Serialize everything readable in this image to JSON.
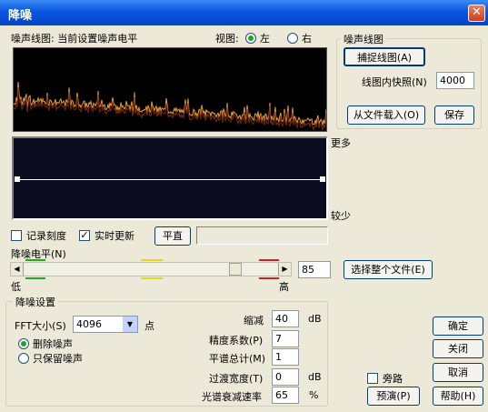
{
  "window": {
    "title": "降噪",
    "close_glyph": "✕"
  },
  "graph": {
    "label": "噪声线图: 当前设置噪声电平",
    "view_label": "视图:",
    "view_left": "左",
    "view_right": "右",
    "view_selected": "左"
  },
  "noise_profile": {
    "group_label": "噪声线图",
    "capture_button": "捕捉线图(A)",
    "snapshots_label": "线图内快照(N)",
    "snapshots_value": "4000",
    "load_button": "从文件载入(O)",
    "save_button": "保存"
  },
  "curve": {
    "more_label": "更多",
    "less_label": "较少"
  },
  "options": {
    "log_scale_label": "记录刻度",
    "log_scale_checked": false,
    "live_update_label": "实时更新",
    "live_update_checked": true,
    "flat_button": "平直"
  },
  "level": {
    "label": "降噪电平(N)",
    "low_label": "低",
    "high_label": "高",
    "value": "85",
    "percent": 85,
    "select_all_button": "选择整个文件(E)"
  },
  "settings": {
    "group_label": "降噪设置",
    "fft_label": "FFT大小(S)",
    "fft_value": "4096",
    "fft_unit": "点",
    "remove_noise_label": "删除噪声",
    "keep_noise_label": "只保留噪声",
    "selected_mode": "删除噪声",
    "reduce_by_label": "缩减",
    "reduce_by_value": "40",
    "reduce_by_unit": "dB",
    "precision_label": "精度系数(P)",
    "precision_value": "7",
    "smoothing_label": "平谱总计(M)",
    "smoothing_value": "1",
    "transition_label": "过渡宽度(T)",
    "transition_value": "0",
    "transition_unit": "dB",
    "decay_label": "光谱衰减速率",
    "decay_value": "65",
    "decay_unit": "%"
  },
  "footer": {
    "bypass_label": "旁路",
    "bypass_checked": false,
    "preview_button": "预演(P)",
    "ok_button": "确定",
    "close_button": "关闭",
    "cancel_button": "取消",
    "help_button": "帮助(H)"
  },
  "colors": {
    "title_bar": "#0856e0",
    "spectrum_line": "#e8a040",
    "curve_line": "#ffffff",
    "marker_green": "#22aa22",
    "marker_yellow": "#e6d420",
    "marker_red": "#cc2222"
  }
}
